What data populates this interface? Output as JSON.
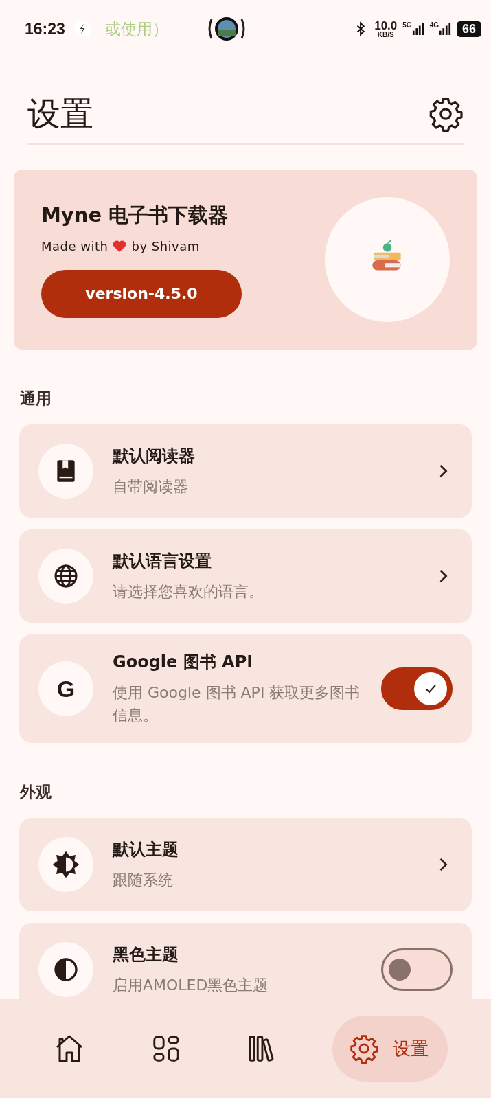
{
  "status_bar": {
    "time": "16:23",
    "notification_text": "或使用）",
    "network_speed": "10.0",
    "speed_unit": "KB/S",
    "signal_1_label": "5G",
    "signal_2_label": "4G",
    "battery": "66"
  },
  "header": {
    "title": "设置"
  },
  "about_card": {
    "app_name": "Myne 电子书下载器",
    "tagline_start": "Made with",
    "tagline_end": "by Shivam",
    "version": "version-4.5.0"
  },
  "sections": [
    {
      "title": "通用",
      "items": [
        {
          "kind": "link",
          "title": "默认阅读器",
          "subtitle": "自带阅读器"
        },
        {
          "kind": "link",
          "title": "默认语言设置",
          "subtitle": "请选择您喜欢的语言。"
        },
        {
          "kind": "switch",
          "icon_text": "G",
          "title": "Google 图书 API",
          "subtitle": "使用 Google 图书 API 获取更多图书信息。",
          "on": true
        }
      ]
    },
    {
      "title": "外观",
      "items": [
        {
          "kind": "link",
          "title": "默认主题",
          "subtitle": "跟随系统"
        },
        {
          "kind": "switch",
          "title": "黑色主题",
          "subtitle": "启用AMOLED黑色主题",
          "on": false
        }
      ]
    }
  ],
  "bottom_nav": [
    {
      "selected": false
    },
    {
      "selected": false
    },
    {
      "selected": false
    },
    {
      "label": "设置",
      "selected": true
    }
  ]
}
